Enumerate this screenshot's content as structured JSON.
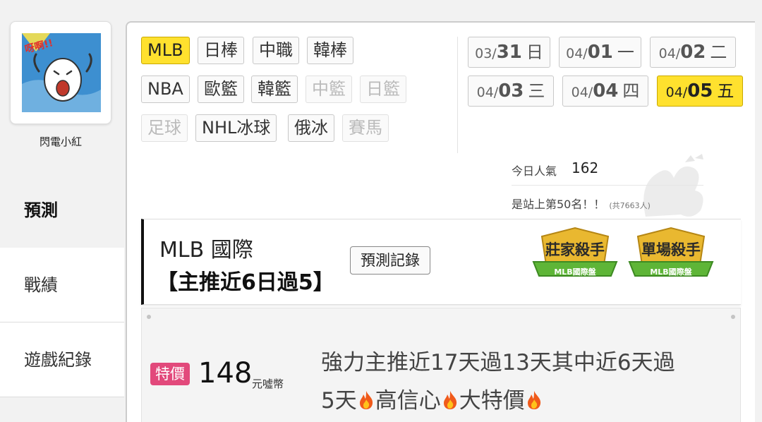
{
  "user": {
    "name": "閃電小紅",
    "avatar_caption": "呀啊!!"
  },
  "nav": {
    "items": [
      "預測",
      "戰績",
      "遊戲紀錄"
    ],
    "active": "預測"
  },
  "leagues": {
    "rows": [
      [
        "MLB",
        "日棒",
        "中職",
        "韓棒"
      ],
      [
        "NBA",
        "歐籃",
        "韓籃",
        "中籃",
        "日籃"
      ],
      [
        "足球",
        "NHL冰球",
        "俄冰",
        "賽馬"
      ]
    ],
    "active": "MLB",
    "disabled": [
      "中籃",
      "日籃",
      "足球",
      "賽馬"
    ]
  },
  "dates": [
    {
      "md": "03/",
      "d": "31",
      "w": "日"
    },
    {
      "md": "04/",
      "d": "01",
      "w": "一"
    },
    {
      "md": "04/",
      "d": "02",
      "w": "二"
    },
    {
      "md": "04/",
      "d": "03",
      "w": "三"
    },
    {
      "md": "04/",
      "d": "04",
      "w": "四"
    },
    {
      "md": "04/",
      "d": "05",
      "w": "五"
    }
  ],
  "active_date": "04/05",
  "popularity": {
    "label": "今日人氣",
    "value": "162",
    "rank_text": "是站上第50名！！",
    "total_text": "(共7663人)"
  },
  "card": {
    "title": "MLB 國際",
    "subtitle": "【主推近6日過5】",
    "record_button": "預測記錄",
    "badges": [
      {
        "title": "莊家殺手",
        "sub": "MLB國際盤"
      },
      {
        "title": "單場殺手",
        "sub": "MLB國際盤"
      }
    ]
  },
  "listing": {
    "tag": "特價",
    "price": "148",
    "currency": "元噓幣",
    "description_line1": "強力主推近17天過13天其中近6天過",
    "description_parts": [
      "5天",
      "高信心",
      "大特價"
    ]
  },
  "colors": {
    "accent_yellow": "#ffe12e",
    "sale_pink": "#e2497b",
    "badge_gold": "#e9b830",
    "badge_green": "#5eb537"
  }
}
